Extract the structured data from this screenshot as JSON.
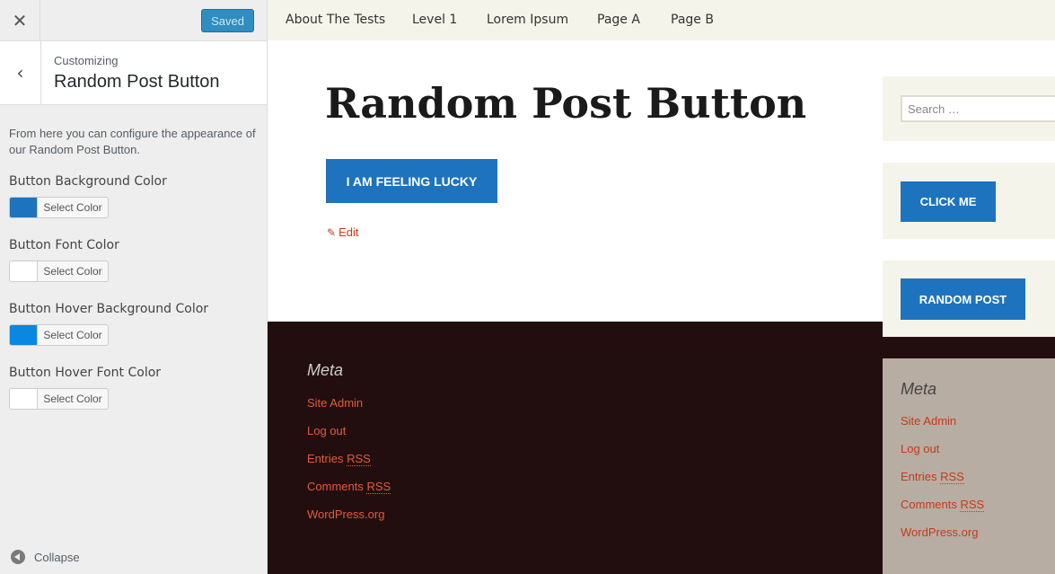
{
  "customizer": {
    "close_symbol": "✕",
    "saved_label": "Saved",
    "back_symbol": "‹",
    "breadcrumb": "Customizing",
    "section_title": "Random Post Button",
    "description": "From here you can configure the appearance of our Random Post Button.",
    "controls": [
      {
        "label": "Button Background Color",
        "button_text": "Select Color",
        "swatch": "#1e73be"
      },
      {
        "label": "Button Font Color",
        "button_text": "Select Color",
        "swatch": "#ffffff"
      },
      {
        "label": "Button Hover Background Color",
        "button_text": "Select Color",
        "swatch": "#0a87e0"
      },
      {
        "label": "Button Hover Font Color",
        "button_text": "Select Color",
        "swatch": "#ffffff"
      }
    ],
    "collapse_label": "Collapse"
  },
  "nav": {
    "items": [
      "About The Tests",
      "Level 1",
      "Lorem Ipsum",
      "Page A",
      "Page B"
    ]
  },
  "content": {
    "title": "Random Post Button",
    "button_label": "I AM FEELING LUCKY",
    "edit_label": "Edit",
    "edit_icon": "✎"
  },
  "footer": {
    "heading": "Meta",
    "links": [
      "Site Admin",
      "Log out",
      "Entries",
      "Comments",
      "WordPress.org"
    ],
    "rss": "RSS"
  },
  "sidebar": {
    "search_placeholder": "Search …",
    "click_me": "CLICK ME",
    "random_post": "RANDOM POST",
    "meta_heading": "Meta",
    "meta_links": [
      "Site Admin",
      "Log out",
      "Entries",
      "Comments",
      "WordPress.org"
    ],
    "rss": "RSS"
  },
  "colors": {
    "button_blue": "#1e73be",
    "saved_blue": "#2e8ec1",
    "footer_bg": "#230e0f",
    "link_red": "#c43a17"
  }
}
